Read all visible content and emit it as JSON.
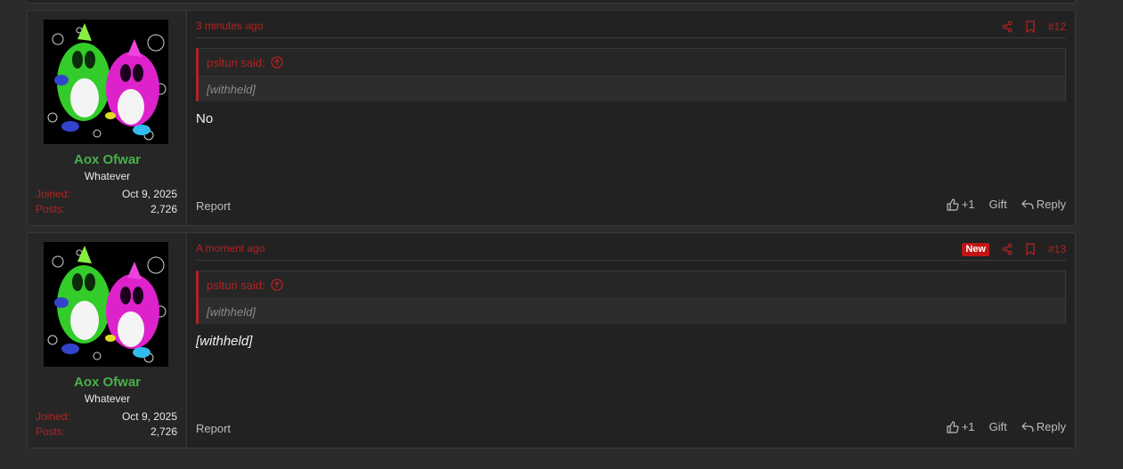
{
  "colors": {
    "page_bg": "#2b2b2b",
    "card_bg": "#222222",
    "accent_red": "#b32222",
    "username_green": "#48b04a",
    "new_badge": "#c11414"
  },
  "posts": [
    {
      "time": "3 minutes ago",
      "post_number": "#12",
      "is_new": false,
      "user": {
        "name": "Aox Ofwar",
        "title": "Whatever",
        "joined_label": "Joined:",
        "joined": "Oct 9, 2025",
        "posts_label": "Posts:",
        "posts": "2,726"
      },
      "quote": {
        "author": "pslturi said:",
        "text": "[withheld]"
      },
      "message": "No",
      "actions": {
        "report": "Report",
        "like": "+1",
        "gift": "Gift",
        "reply": "Reply"
      }
    },
    {
      "time": "A moment ago",
      "post_number": "#13",
      "is_new": true,
      "new_label": "New",
      "user": {
        "name": "Aox Ofwar",
        "title": "Whatever",
        "joined_label": "Joined:",
        "joined": "Oct 9, 2025",
        "posts_label": "Posts:",
        "posts": "2,726"
      },
      "quote": {
        "author": "pslturi said:",
        "text": "[withheld]"
      },
      "message": "[withheld]",
      "actions": {
        "report": "Report",
        "like": "+1",
        "gift": "Gift",
        "reply": "Reply"
      }
    }
  ],
  "icons": [
    "share-icon",
    "bookmark-icon",
    "thumbs-up-icon",
    "reply-icon",
    "go-to-quote-icon"
  ]
}
